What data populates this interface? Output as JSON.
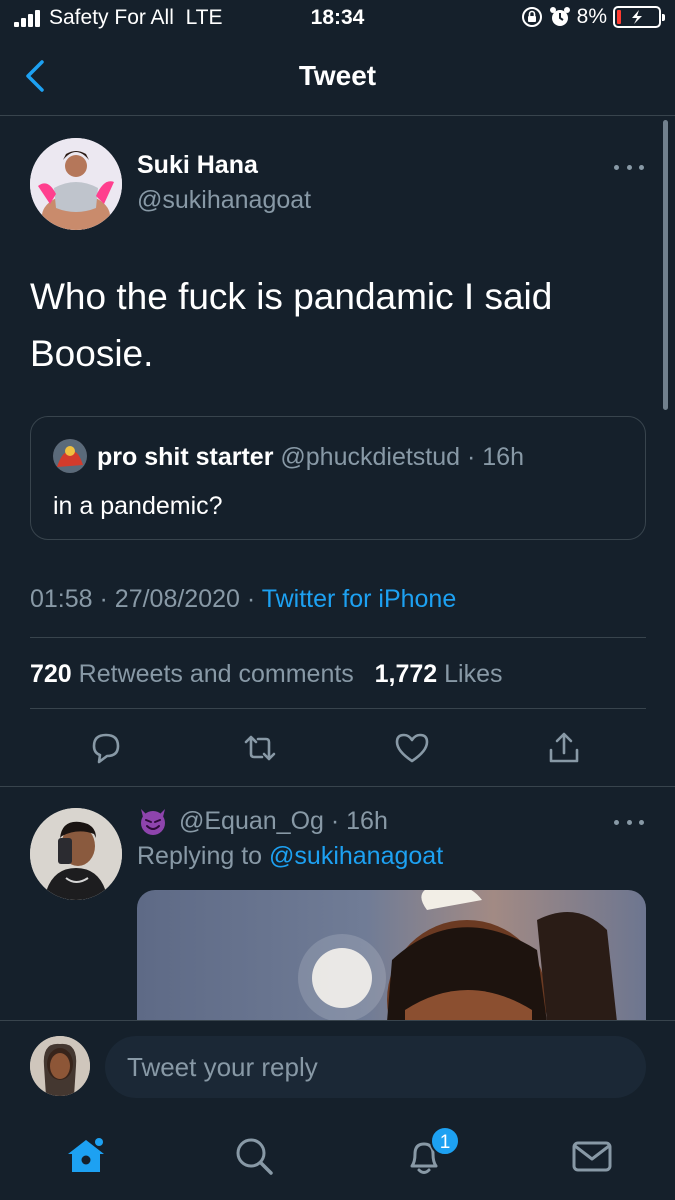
{
  "status_bar": {
    "carrier": "Safety For All",
    "network": "LTE",
    "time": "18:34",
    "battery": "8%",
    "battery_level": 0.08,
    "icons": [
      "signal-icon",
      "orientation-lock-icon",
      "alarm-icon",
      "battery-charging-icon"
    ]
  },
  "header": {
    "title": "Tweet",
    "back_icon": "chevron-left-icon"
  },
  "tweet": {
    "author_name": "Suki Hana",
    "author_handle": "@sukihanagoat",
    "text": "Who the fuck is pandamic I said Boosie.",
    "quote": {
      "name": "pro shit starter",
      "meta": "@phuckdietstud · 16h",
      "text": "in a pandemic?"
    },
    "time": "01:58",
    "date": "27/08/2020",
    "client": "Twitter for iPhone",
    "retweets_count": "720",
    "retweets_label": "Retweets and comments",
    "likes_count": "1,772",
    "likes_label": "Likes",
    "actions": [
      "reply-icon",
      "retweet-icon",
      "like-icon",
      "share-icon"
    ]
  },
  "reply": {
    "emoji": "smiling-devil-emoji",
    "meta": "@Equan_Og · 16h",
    "replying_prefix": "Replying to",
    "replying_to": "@sukihanagoat"
  },
  "compose": {
    "placeholder": "Tweet your reply"
  },
  "tabbar": {
    "tabs": [
      "home-icon",
      "search-icon",
      "notifications-icon",
      "messages-icon"
    ],
    "notifications_badge": "1"
  },
  "colors": {
    "background": "#15202b",
    "divider": "#38444d",
    "secondary_text": "#8899a6",
    "accent": "#1da1f2",
    "battery_low": "#ff3b30"
  }
}
